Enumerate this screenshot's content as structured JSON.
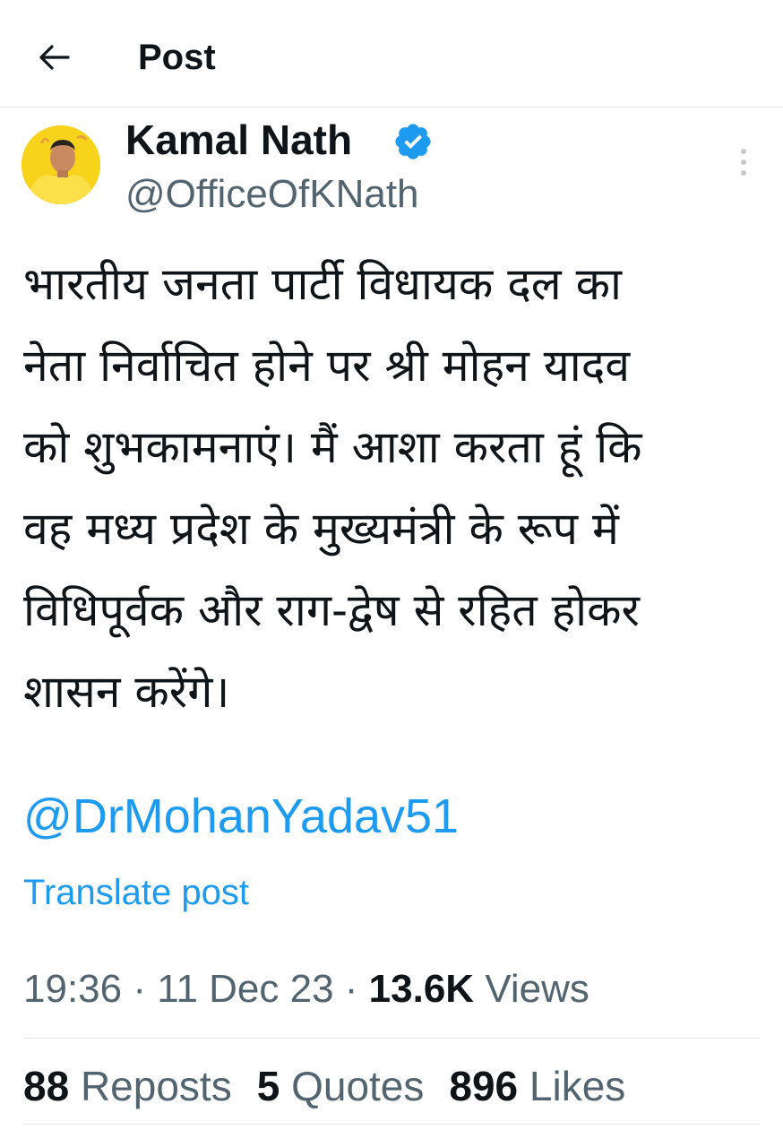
{
  "header": {
    "back_icon": "arrow-left-icon",
    "title": "Post"
  },
  "author": {
    "name": "Kamal Nath",
    "handle": "@OfficeOfKNath",
    "verified_icon": "verified-badge-icon",
    "verified_color": "#1d9bf0"
  },
  "more_icon": "more-vertical-icon",
  "post": {
    "text": "भारतीय जनता पार्टी विधायक दल का\nनेता निर्वाचित होने पर श्री मोहन यादव\nको शुभकामनाएं। मैं आशा करता हूं कि\nवह मध्य प्रदेश के मुख्यमंत्री के रूप में\nविधिपूर्वक और राग-द्वेष से रहित होकर\nशासन करेंगे।",
    "mention": "@DrMohanYadav51",
    "translate_label": "Translate post"
  },
  "meta": {
    "time": "19:36",
    "date": "11 Dec 23",
    "separator": "·",
    "views_count": "13.6K",
    "views_label": "Views"
  },
  "stats": {
    "reposts_count": "88",
    "reposts_label": "Reposts",
    "quotes_count": "5",
    "quotes_label": "Quotes",
    "likes_count": "896",
    "likes_label": "Likes"
  },
  "colors": {
    "accent": "#1d9bf0",
    "text": "#0f1419",
    "muted": "#536471"
  }
}
